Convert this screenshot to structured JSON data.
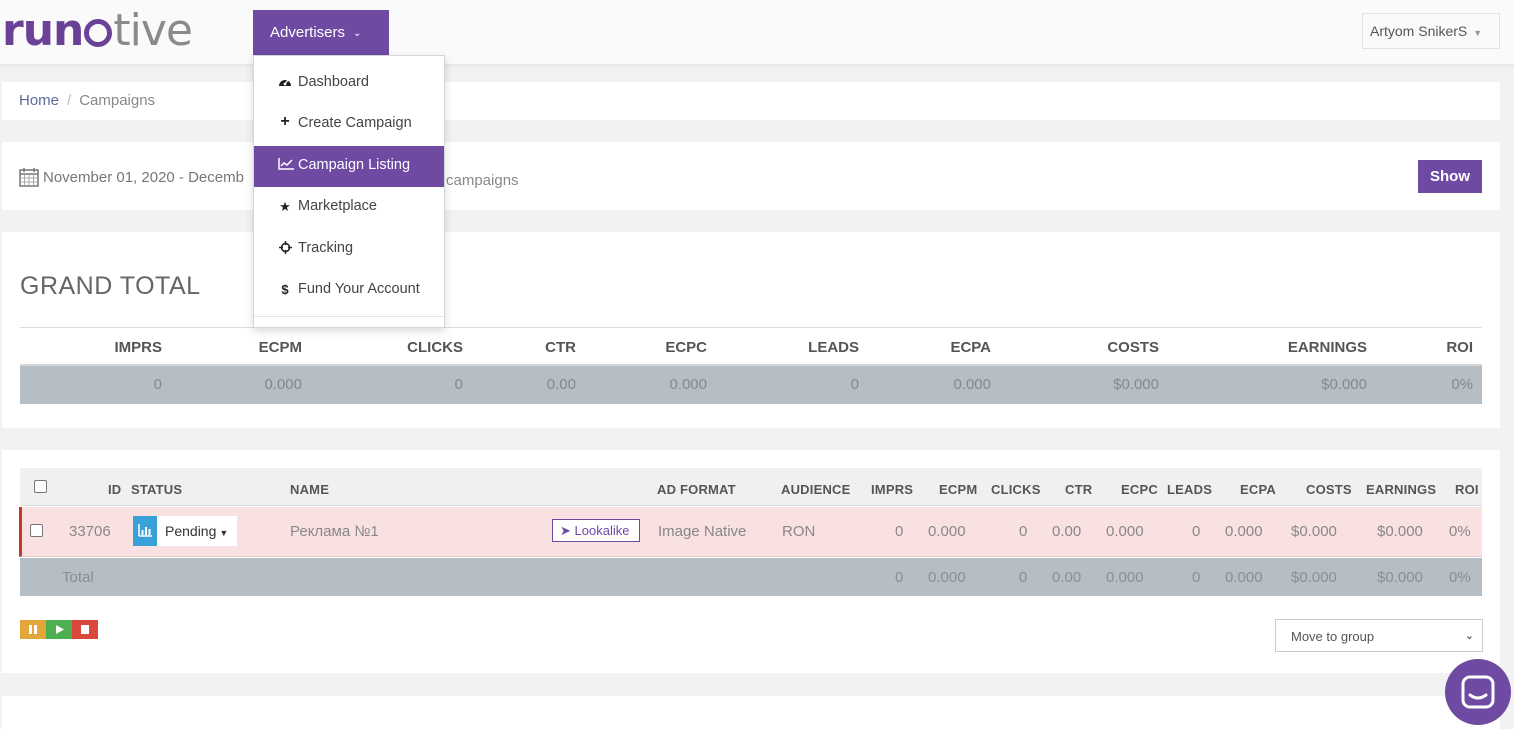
{
  "brand": {
    "logo_run": "run",
    "logo_ative": "tive",
    "accent": "#6e4aa3"
  },
  "header": {
    "menu_label": "Advertisers",
    "user_name": "Artyom SnikerS"
  },
  "menu": {
    "items": [
      {
        "label": "Dashboard",
        "icon": "dashboard-icon"
      },
      {
        "label": "Create Campaign",
        "icon": "plus-icon"
      },
      {
        "label": "Campaign Listing",
        "icon": "line-chart-icon"
      },
      {
        "label": "Marketplace",
        "icon": "star-icon"
      },
      {
        "label": "Tracking",
        "icon": "crosshair-icon"
      },
      {
        "label": "Fund Your Account",
        "icon": "dollar-icon"
      }
    ],
    "active_index": 2
  },
  "breadcrumb": {
    "home": "Home",
    "separator": "/",
    "current": "Campaigns"
  },
  "filter": {
    "date_range": "November 01, 2020 - Decemb",
    "campaigns_text": "campaigns",
    "show_label": "Show"
  },
  "grand_total": {
    "title": "GRAND TOTAL",
    "headers": [
      "IMPRS",
      "ECPM",
      "CLICKS",
      "CTR",
      "ECPC",
      "LEADS",
      "ECPA",
      "COSTS",
      "EARNINGS",
      "ROI"
    ],
    "values": [
      "0",
      "0.000",
      "0",
      "0.00",
      "0.000",
      "0",
      "0.000",
      "$0.000",
      "$0.000",
      "0%"
    ]
  },
  "campaigns": {
    "headers": {
      "id": "ID",
      "status": "STATUS",
      "name": "NAME",
      "ad_format": "AD FORMAT",
      "audience": "AUDIENCE",
      "imprs": "IMPRS",
      "ecpm": "ECPM",
      "clicks": "CLICKS",
      "ctr": "CTR",
      "ecpc": "ECPC",
      "leads": "LEADS",
      "ecpa": "ECPA",
      "costs": "COSTS",
      "earnings": "EARNINGS",
      "roi": "ROI"
    },
    "row": {
      "id": "33706",
      "status": "Pending",
      "name": "Реклама №1",
      "tag": "Lookalike",
      "ad_format": "Image Native",
      "audience": "RON",
      "imprs": "0",
      "ecpm": "0.000",
      "clicks": "0",
      "ctr": "0.00",
      "ecpc": "0.000",
      "leads": "0",
      "ecpa": "0.000",
      "costs": "$0.000",
      "earnings": "$0.000",
      "roi": "0%"
    },
    "total": {
      "label": "Total",
      "imprs": "0",
      "ecpm": "0.000",
      "clicks": "0",
      "ctr": "0.00",
      "ecpc": "0.000",
      "leads": "0",
      "ecpa": "0.000",
      "costs": "$0.000",
      "earnings": "$0.000",
      "roi": "0%"
    },
    "move_to_group": "Move to group"
  }
}
